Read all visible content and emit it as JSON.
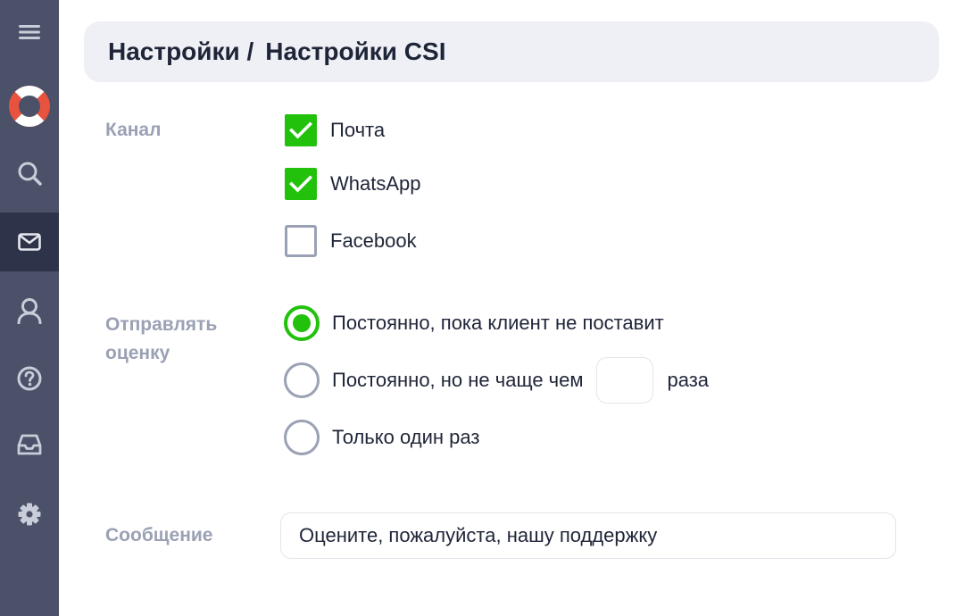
{
  "sidebar": {
    "items": [
      {
        "icon": "menu-icon"
      },
      {
        "icon": "lifebuoy-logo-icon"
      },
      {
        "icon": "search-icon"
      },
      {
        "icon": "mail-icon",
        "active": true
      },
      {
        "icon": "user-icon"
      },
      {
        "icon": "help-icon"
      },
      {
        "icon": "inbox-icon"
      },
      {
        "icon": "gear-icon"
      }
    ]
  },
  "header": {
    "breadcrumb_parent": "Настройки /",
    "breadcrumb_current": "Настройки CSI"
  },
  "channel": {
    "label": "Канал",
    "options": [
      {
        "label": "Почта",
        "checked": true
      },
      {
        "label": "WhatsApp",
        "checked": true
      },
      {
        "label": "Facebook",
        "checked": false
      }
    ]
  },
  "send_rating": {
    "label": "Отправлять оценку",
    "options": [
      {
        "label": "Постоянно, пока клиент не поставит",
        "selected": true
      },
      {
        "label": "Постоянно, но не чаще чем",
        "selected": false,
        "suffix": "раза",
        "input_value": ""
      },
      {
        "label": "Только один раз",
        "selected": false
      }
    ]
  },
  "message": {
    "label": "Сообщение",
    "value": "Оцените, пожалуйста, нашу поддержку"
  },
  "colors": {
    "sidebar": "#4a5168",
    "sidebar_active": "#2d3348",
    "accent_green": "#22c10c",
    "label_gray": "#9ba1b5",
    "text_dark": "#1f2538"
  }
}
